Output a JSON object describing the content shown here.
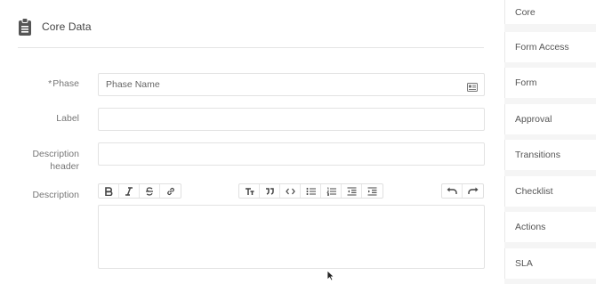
{
  "header": {
    "title": "Core Data",
    "icon": "clipboard-icon"
  },
  "form": {
    "phase": {
      "label": "Phase",
      "required_mark": "*",
      "placeholder": "Phase Name"
    },
    "label": {
      "label": "Label",
      "value": ""
    },
    "description_header": {
      "label": "Description header",
      "value": ""
    },
    "description": {
      "label": "Description",
      "value": ""
    }
  },
  "toolbar": {
    "groups": [
      [
        "bold-icon",
        "italic-icon",
        "strikethrough-icon",
        "link-icon"
      ],
      [
        "text-size-icon",
        "quote-icon",
        "code-icon",
        "bullet-list-icon",
        "numbered-list-icon",
        "outdent-icon",
        "indent-icon"
      ],
      [
        "undo-icon",
        "redo-icon"
      ]
    ]
  },
  "sidebar": {
    "items": [
      {
        "label": "Core",
        "active": true
      },
      {
        "label": "Form Access"
      },
      {
        "label": "Form"
      },
      {
        "label": "Approval"
      },
      {
        "label": "Transitions"
      },
      {
        "label": "Checklist"
      },
      {
        "label": "Actions"
      },
      {
        "label": "SLA"
      }
    ]
  }
}
